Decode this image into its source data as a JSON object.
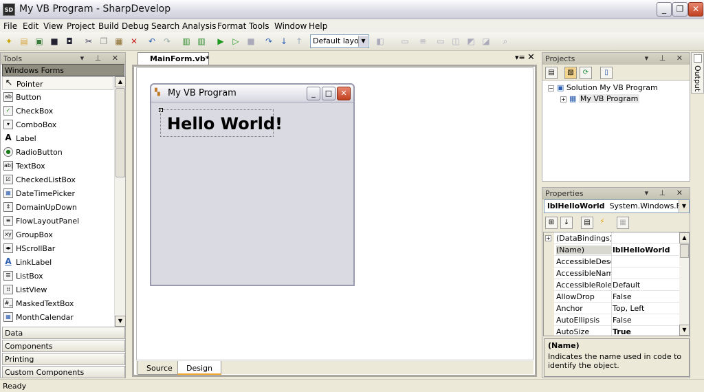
{
  "window": {
    "title": "My VB Program - SharpDevelop",
    "icon": "SD"
  },
  "menu": [
    "File",
    "Edit",
    "View",
    "Project",
    "Build",
    "Debug",
    "Search",
    "Analysis",
    "Format",
    "Tools",
    "Window",
    "Help"
  ],
  "toolbar": {
    "layout_value": "Default layout"
  },
  "tools_pad": {
    "title": "Tools",
    "section": "Windows Forms",
    "items": [
      "Pointer",
      "Button",
      "CheckBox",
      "ComboBox",
      "Label",
      "RadioButton",
      "TextBox",
      "CheckedListBox",
      "DateTimePicker",
      "DomainUpDown",
      "FlowLayoutPanel",
      "GroupBox",
      "HScrollBar",
      "LinkLabel",
      "ListBox",
      "ListView",
      "MaskedTextBox",
      "MonthCalendar"
    ],
    "categories": [
      "Data",
      "Components",
      "Printing",
      "Custom Components"
    ]
  },
  "document": {
    "tab_label": "MainForm.vb*",
    "form_title": "My VB Program",
    "label_text": "Hello World!",
    "bottom_tabs": [
      "Source",
      "Design"
    ]
  },
  "projects_pad": {
    "title": "Projects",
    "solution": "Solution My VB Program",
    "project": "My VB Program"
  },
  "properties_pad": {
    "title": "Properties",
    "selected_object": "lblHelloWorld",
    "selected_type": "System.Windows.Fo",
    "rows": [
      {
        "name": "(DataBindings)",
        "value": "",
        "bold": false,
        "expand": true
      },
      {
        "name": "(Name)",
        "value": "lblHelloWorld",
        "bold": true,
        "expand": false
      },
      {
        "name": "AccessibleDescri",
        "value": "",
        "bold": false,
        "expand": false
      },
      {
        "name": "AccessibleName",
        "value": "",
        "bold": false,
        "expand": false
      },
      {
        "name": "AccessibleRole",
        "value": "Default",
        "bold": false,
        "expand": false
      },
      {
        "name": "AllowDrop",
        "value": "False",
        "bold": false,
        "expand": false
      },
      {
        "name": "Anchor",
        "value": "Top, Left",
        "bold": false,
        "expand": false
      },
      {
        "name": "AutoEllipsis",
        "value": "False",
        "bold": false,
        "expand": false
      },
      {
        "name": "AutoSize",
        "value": "True",
        "bold": true,
        "expand": false
      }
    ],
    "desc_title": "(Name)",
    "desc_text": "Indicates the name used in code to identify the object."
  },
  "output_tab": "Output",
  "status": "Ready"
}
